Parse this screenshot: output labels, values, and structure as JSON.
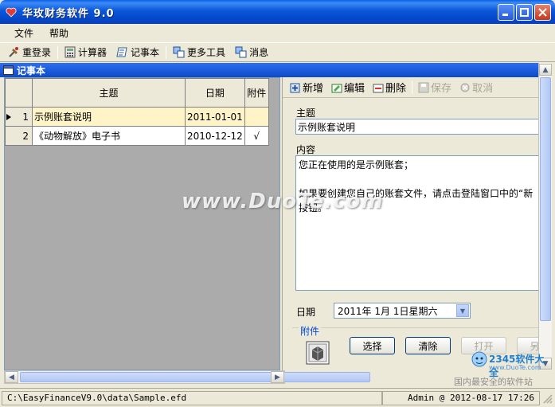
{
  "window": {
    "title": "华玫财务软件 9.0"
  },
  "menu": [
    {
      "label": "文件"
    },
    {
      "label": "帮助"
    }
  ],
  "toolbar": [
    {
      "label": "重登录",
      "icon": "relogin-icon"
    },
    {
      "label": "计算器",
      "icon": "calculator-icon"
    },
    {
      "label": "记事本",
      "icon": "notepad-icon"
    },
    {
      "label": "更多工具",
      "icon": "tools-icon"
    },
    {
      "label": "消息",
      "icon": "message-icon"
    }
  ],
  "panel": {
    "title": "记事本"
  },
  "grid": {
    "columns": [
      "主题",
      "日期",
      "附件"
    ],
    "rows": [
      {
        "index": "1",
        "subject": "示例账套说明",
        "date": "2011-01-01",
        "attachment": "",
        "selected": true
      },
      {
        "index": "2",
        "subject": "《动物解放》电子书",
        "date": "2010-12-12",
        "attachment": "√",
        "selected": false
      }
    ]
  },
  "detail": {
    "toolbar": [
      {
        "label": "新增",
        "icon": "add-icon",
        "enabled": true
      },
      {
        "label": "编辑",
        "icon": "edit-icon",
        "enabled": true
      },
      {
        "label": "删除",
        "icon": "delete-icon",
        "enabled": true
      },
      {
        "label": "保存",
        "icon": "save-icon",
        "enabled": false
      },
      {
        "label": "取消",
        "icon": "cancel-icon",
        "enabled": false
      }
    ],
    "subject_label": "主题",
    "subject_value": "示例账套说明",
    "content_label": "内容",
    "content_value": "您正在使用的是示例账套；\n\n如果要创建您自己的账套文件，请点击登陆窗口中的“新\n按钮。",
    "date_label": "日期",
    "date_value": "2011年 1月 1日星期六",
    "attachment_label": "附件",
    "buttons": [
      {
        "label": "选择",
        "enabled": true
      },
      {
        "label": "清除",
        "enabled": true
      },
      {
        "label": "打开",
        "enabled": false
      },
      {
        "label": "另存",
        "enabled": false
      }
    ]
  },
  "status": {
    "path": "C:\\EasyFinanceV9.0\\data\\Sample.efd",
    "user_time": "Admin @ 2012-08-17 17:26"
  },
  "watermark": {
    "main": "www.DuoTe.com",
    "brand": "2345软件大全",
    "url": "www.DuoTe.com",
    "slogan": "国内最安全的软件站"
  }
}
